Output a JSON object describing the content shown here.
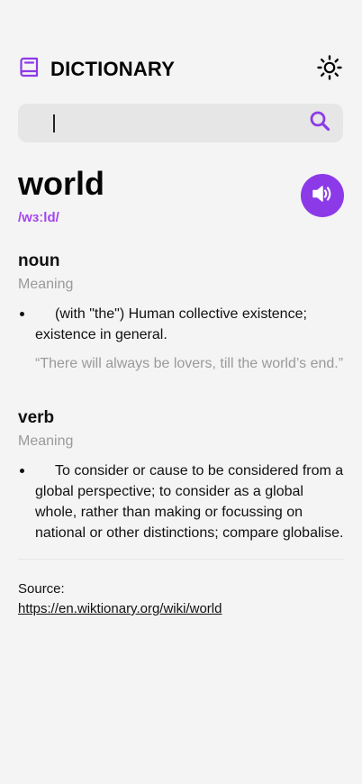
{
  "header": {
    "title": "DICTIONARY",
    "logo_icon": "book-icon",
    "theme_icon": "sun-icon"
  },
  "search": {
    "value": "",
    "placeholder": "",
    "icon": "search-icon"
  },
  "entry": {
    "word": "world",
    "phonetic": "/wɜːld/",
    "play_icon": "speaker-icon"
  },
  "meanings": [
    {
      "part_of_speech": "noun",
      "label": "Meaning",
      "definitions": [
        "(with \"the\") Human collective existence; existence in general."
      ],
      "example": "“There will always be lovers, till the world’s end.”"
    },
    {
      "part_of_speech": "verb",
      "label": "Meaning",
      "definitions": [
        "To consider or cause to be considered from a global perspective; to consider as a global whole, rather than making or focussing on national or other distinctions; compare globalise."
      ]
    }
  ],
  "source": {
    "label": "Source:",
    "url": "https://en.wiktionary.org/wiki/world"
  },
  "colors": {
    "accent": "#a445ed",
    "play_button": "#8c3ae8",
    "background": "#f4f4f4",
    "search_bg": "#e6e6e6",
    "muted_text": "#9a9a9a"
  }
}
